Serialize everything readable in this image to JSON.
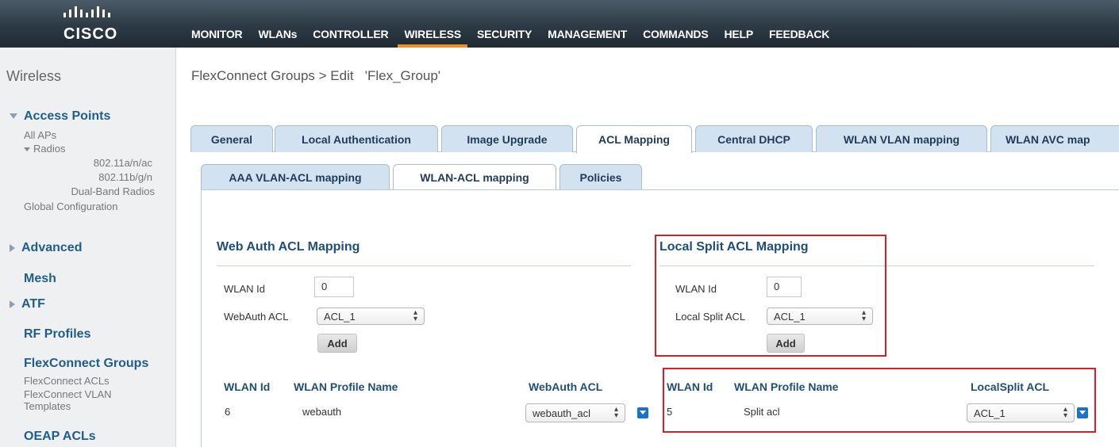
{
  "header": {
    "logo_text": "CISCO",
    "nav": [
      "MONITOR",
      "WLANs",
      "CONTROLLER",
      "WIRELESS",
      "SECURITY",
      "MANAGEMENT",
      "COMMANDS",
      "HELP",
      "FEEDBACK"
    ],
    "active_nav": "WIRELESS",
    "accent_color": "#e8902b"
  },
  "sidebar": {
    "title": "Wireless",
    "access_points": "Access Points",
    "all_aps": "All APs",
    "radios": "Radios",
    "radio_items": [
      "802.11a/n/ac",
      "802.11b/g/n",
      "Dual-Band Radios"
    ],
    "global_config": "Global Configuration",
    "advanced": "Advanced",
    "mesh": "Mesh",
    "atf": "ATF",
    "rf_profiles": "RF Profiles",
    "flexconnect_groups": "FlexConnect Groups",
    "flexconnect_acls": "FlexConnect ACLs",
    "flexconnect_vlan_templates": "FlexConnect VLAN Templates",
    "oeap_acls": "OEAP ACLs"
  },
  "breadcrumb": "FlexConnect Groups > Edit   'Flex_Group'",
  "tabs": [
    "General",
    "Local Authentication",
    "Image Upgrade",
    "ACL Mapping",
    "Central DHCP",
    "WLAN VLAN mapping",
    "WLAN AVC map"
  ],
  "subtabs": [
    "AAA VLAN-ACL mapping",
    "WLAN-ACL mapping",
    "Policies"
  ],
  "webauth": {
    "title": "Web Auth ACL Mapping",
    "wlan_id_label": "WLAN Id",
    "wlan_id_value": "0",
    "acl_label": "WebAuth ACL",
    "acl_value": "ACL_1",
    "add_label": "Add",
    "columns": [
      "WLAN Id",
      "WLAN Profile Name",
      "WebAuth ACL"
    ],
    "rows": [
      {
        "id": "6",
        "profile": "webauth",
        "acl": "webauth_acl"
      }
    ]
  },
  "localsplit": {
    "title": "Local Split ACL Mapping",
    "wlan_id_label": "WLAN Id",
    "wlan_id_value": "0",
    "acl_label": "Local Split ACL",
    "acl_value": "ACL_1",
    "add_label": "Add",
    "columns": [
      "WLAN Id",
      "WLAN Profile Name",
      "LocalSplit ACL"
    ],
    "rows": [
      {
        "id": "5",
        "profile": "Split acl",
        "acl": "ACL_1"
      }
    ]
  },
  "highlight_color": "#d71f26"
}
